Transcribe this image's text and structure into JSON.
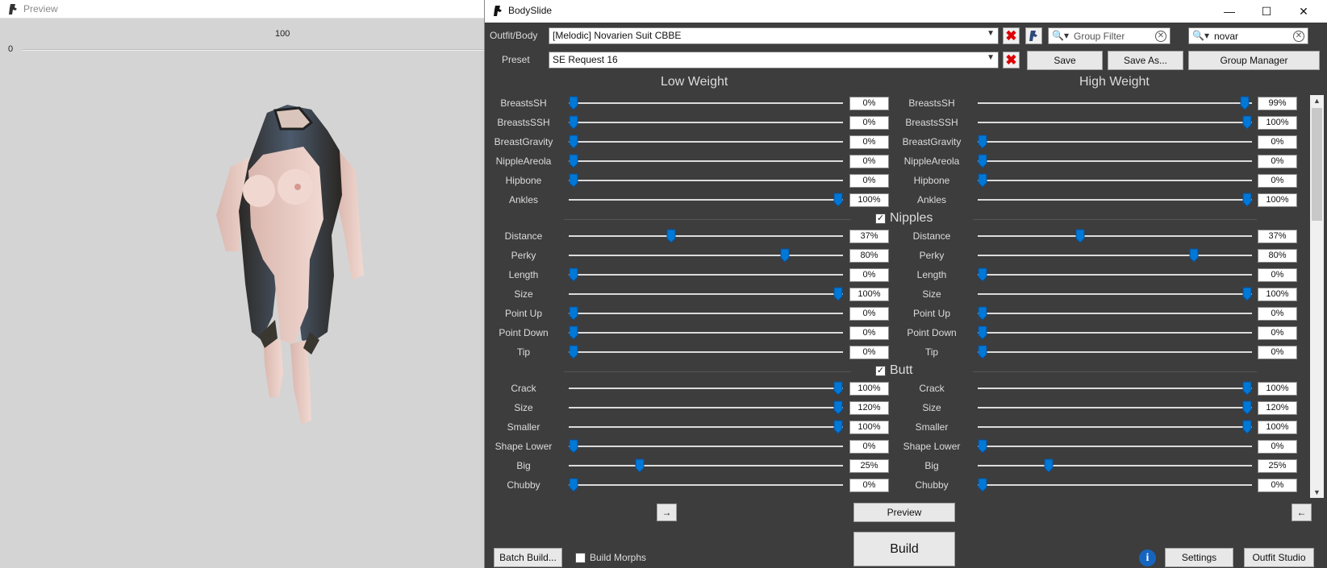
{
  "preview": {
    "title": "Preview",
    "ruler_min": "0",
    "ruler_max": "100"
  },
  "app": {
    "title": "BodySlide"
  },
  "window_controls": {
    "minimize": "—",
    "maximize": "☐",
    "close": "✕"
  },
  "outfit": {
    "label": "Outfit/Body",
    "value": "[Melodic] Novarien Suit CBBE"
  },
  "group_filter": {
    "placeholder": "Group Filter"
  },
  "outfit_filter": {
    "value": "novar"
  },
  "preset": {
    "label": "Preset",
    "value": "SE Request 16"
  },
  "buttons": {
    "save": "Save",
    "save_as": "Save As...",
    "group_manager": "Group Manager",
    "preview": "Preview",
    "build": "Build",
    "batch_build": "Batch Build...",
    "settings": "Settings",
    "outfit_studio": "Outfit Studio",
    "copy_right": "→",
    "copy_left": "←"
  },
  "build_morphs": {
    "label": "Build Morphs",
    "checked": false
  },
  "columns": {
    "low": "Low Weight",
    "high": "High Weight"
  },
  "groups": {
    "nipples": "Nipples",
    "butt": "Butt"
  },
  "sliders": [
    {
      "name": "BreastsSH",
      "low": 0,
      "high": 99
    },
    {
      "name": "BreastsSSH",
      "low": 0,
      "high": 100
    },
    {
      "name": "BreastGravity",
      "low": 0,
      "high": 0
    },
    {
      "name": "NippleAreola",
      "low": 0,
      "high": 0
    },
    {
      "name": "Hipbone",
      "low": 0,
      "high": 0
    },
    {
      "name": "Ankles",
      "low": 100,
      "high": 100
    },
    {
      "name": "Distance",
      "low": 37,
      "high": 37
    },
    {
      "name": "Perky",
      "low": 80,
      "high": 80
    },
    {
      "name": "Length",
      "low": 0,
      "high": 0
    },
    {
      "name": "Size",
      "low": 100,
      "high": 100
    },
    {
      "name": "Point Up",
      "low": 0,
      "high": 0
    },
    {
      "name": "Point Down",
      "low": 0,
      "high": 0
    },
    {
      "name": "Tip",
      "low": 0,
      "high": 0
    },
    {
      "name": "Crack",
      "low": 100,
      "high": 100
    },
    {
      "name": "Size",
      "low": 120,
      "high": 120
    },
    {
      "name": "Smaller",
      "low": 100,
      "high": 100
    },
    {
      "name": "Shape Lower",
      "low": 0,
      "high": 0
    },
    {
      "name": "Big",
      "low": 25,
      "high": 25
    },
    {
      "name": "Chubby",
      "low": 0,
      "high": 0
    }
  ],
  "colors": {
    "accent": "#0078d7",
    "panel": "#3d3d3d",
    "close_x": "#d00000"
  }
}
